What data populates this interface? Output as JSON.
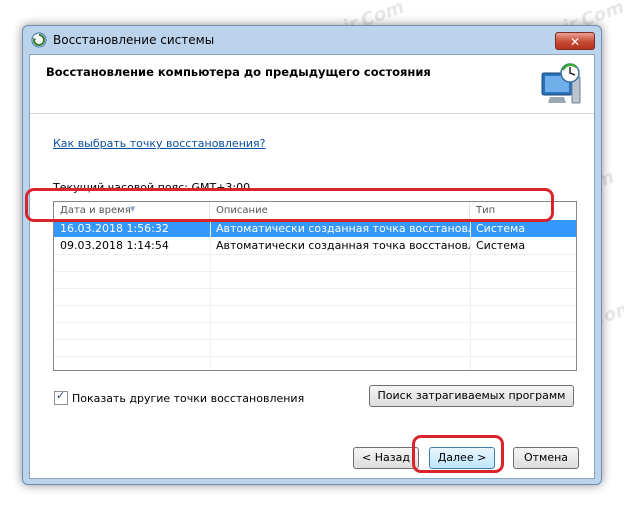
{
  "window": {
    "title": "Восстановление системы",
    "close_glyph": "✕"
  },
  "header": {
    "title": "Восстановление компьютера до предыдущего состояния"
  },
  "link_text": "Как выбрать точку восстановления?",
  "timezone_text": "Текущий часовой пояс: GMT+3:00",
  "table": {
    "columns": [
      "Дата и время",
      "Описание",
      "Тип"
    ],
    "rows": [
      {
        "date": "16.03.2018 1:56:32",
        "description": "Автоматически созданная точка восстановле...",
        "type": "Система",
        "selected": true
      },
      {
        "date": "09.03.2018 1:14:54",
        "description": "Автоматически созданная точка восстановле...",
        "type": "Система",
        "selected": false
      }
    ]
  },
  "show_more": {
    "label": "Показать другие точки восстановления",
    "checked": true
  },
  "buttons": {
    "scan": "Поиск затрагиваемых программ",
    "back": "< Назад",
    "next": "Далее >",
    "cancel": "Отмена"
  },
  "watermark": "Soringpcrepair.Com",
  "colors": {
    "selection": "#3399ff",
    "highlight": "#d9242c",
    "link": "#0b4ea2"
  }
}
